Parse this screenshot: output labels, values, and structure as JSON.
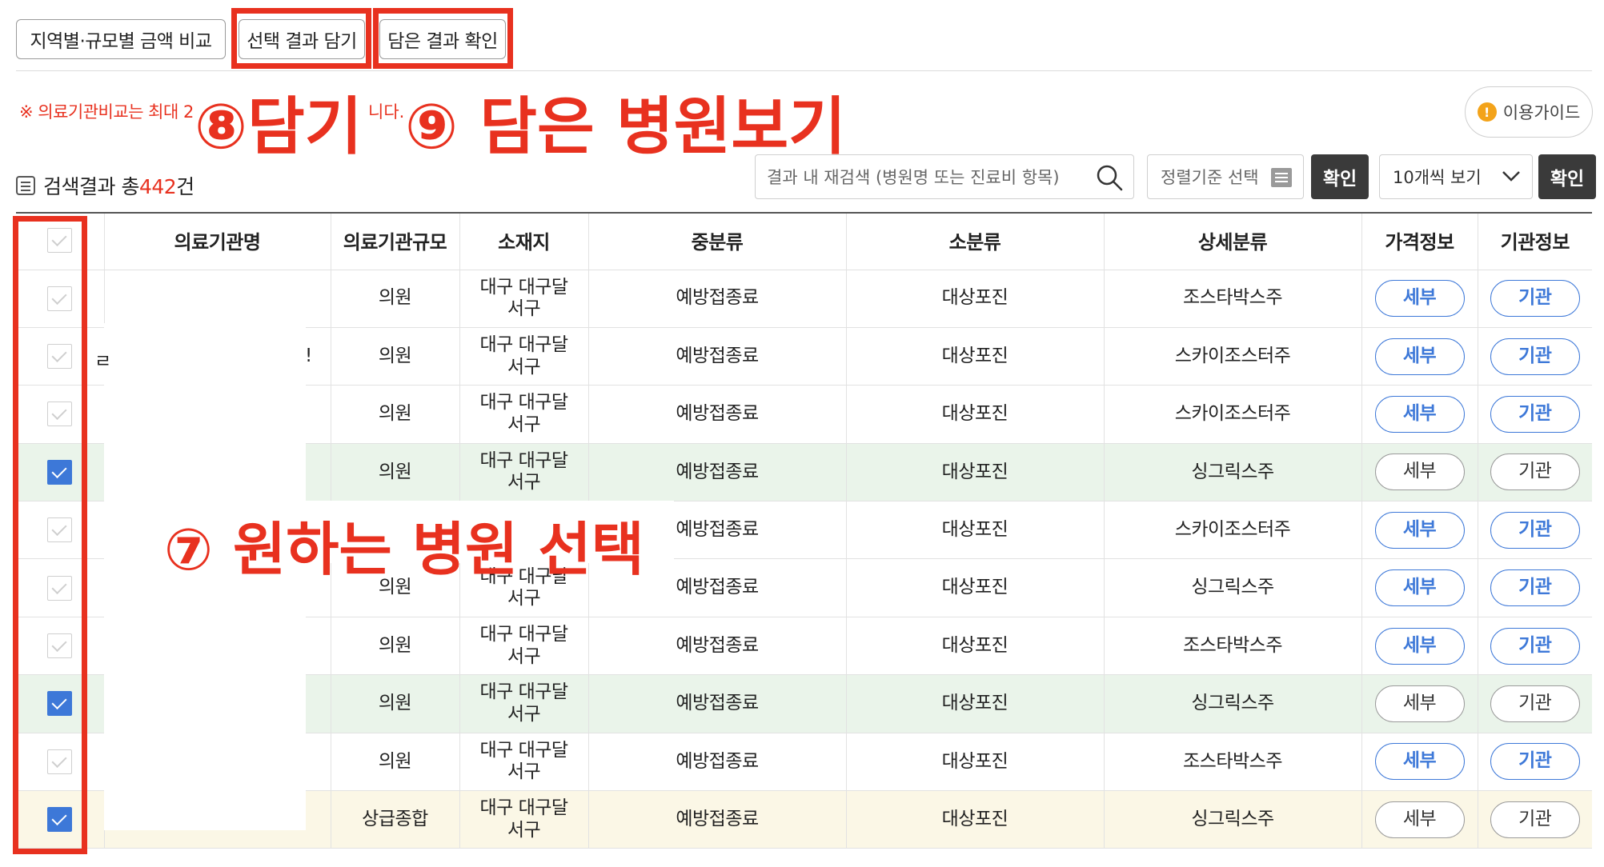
{
  "toolbar": {
    "compare_label": "지역별·규모별 금액 비교",
    "add_label": "선택 결과 담기",
    "view_label": "담은 결과 확인"
  },
  "notice": {
    "text": "※ 의료기관비교는 최대 2",
    "text_end": "니다."
  },
  "annotations": {
    "step8": "⑧담기",
    "step9": "⑨ 담은 병원보기",
    "step7": "⑦ 원하는 병원 선택"
  },
  "guide": {
    "label": "이용가이드"
  },
  "results": {
    "prefix": "검색결과 총",
    "count": "442",
    "suffix": "건"
  },
  "search": {
    "placeholder": "결과 내 재검색 (병원명 또는 진료비 항목)"
  },
  "sort": {
    "label": "정렬기준 선택"
  },
  "confirm_label": "확인",
  "per_page": {
    "selected": "10개씩 보기"
  },
  "colors": {
    "accent_red": "#e8311f",
    "check_blue": "#3d78d8",
    "dark_button": "#3a3a3a"
  },
  "table": {
    "headers": [
      "",
      "의료기관명",
      "의료기관규모",
      "소재지",
      "중분류",
      "소분류",
      "상세분류",
      "가격정보",
      "기관정보"
    ],
    "detail_label": "세부",
    "org_label": "기관",
    "rows": [
      {
        "checked": false,
        "size": "의원",
        "loc": "대구 대구달\n서구",
        "mid": "예방접종료",
        "small": "대상포진",
        "detail": "조스타박스주"
      },
      {
        "checked": false,
        "size": "의원",
        "loc": "대구 대구달\n서구",
        "mid": "예방접종료",
        "small": "대상포진",
        "detail": "스카이조스터주"
      },
      {
        "checked": false,
        "size": "의원",
        "loc": "대구 대구달\n서구",
        "mid": "예방접종료",
        "small": "대상포진",
        "detail": "스카이조스터주"
      },
      {
        "checked": true,
        "size": "의원",
        "loc": "대구 대구달\n서구",
        "mid": "예방접종료",
        "small": "대상포진",
        "detail": "싱그릭스주"
      },
      {
        "checked": false,
        "size": "",
        "loc": "",
        "mid": "예방접종료",
        "small": "대상포진",
        "detail": "스카이조스터주"
      },
      {
        "checked": false,
        "size": "의원",
        "loc": "대구 대구달\n서구",
        "mid": "예방접종료",
        "small": "대상포진",
        "detail": "싱그릭스주"
      },
      {
        "checked": false,
        "size": "의원",
        "loc": "대구 대구달\n서구",
        "mid": "예방접종료",
        "small": "대상포진",
        "detail": "조스타박스주"
      },
      {
        "checked": true,
        "size": "의원",
        "loc": "대구 대구달\n서구",
        "mid": "예방접종료",
        "small": "대상포진",
        "detail": "싱그릭스주"
      },
      {
        "checked": false,
        "size": "의원",
        "loc": "대구 대구달\n서구",
        "mid": "예방접종료",
        "small": "대상포진",
        "detail": "조스타박스주"
      },
      {
        "checked": true,
        "size": "상급종합",
        "loc": "대구 대구달\n서구",
        "mid": "예방접종료",
        "small": "대상포진",
        "detail": "싱그릭스주"
      }
    ]
  }
}
